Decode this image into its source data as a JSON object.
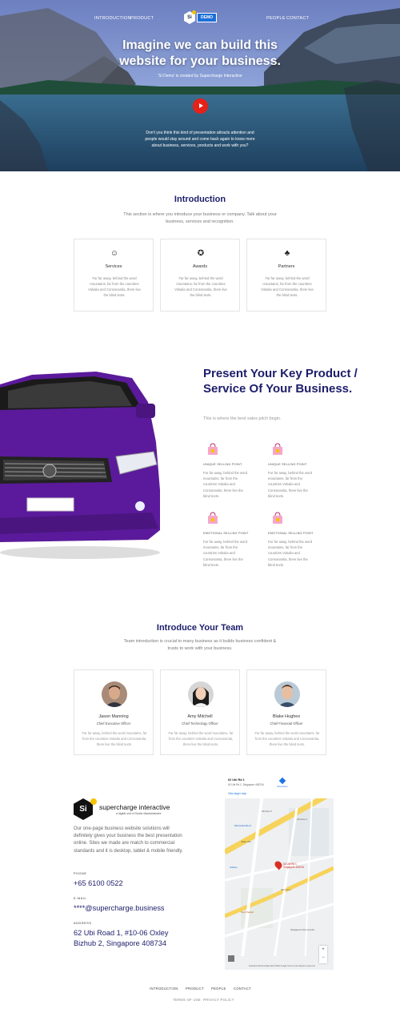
{
  "nav": {
    "links_left": [
      "INTRODUCTION",
      "PRODUCT"
    ],
    "links_right": [
      "PEOPLE",
      "CONTACT"
    ],
    "logo_text": "Si",
    "badge": "DEMO"
  },
  "hero": {
    "title_line1": "Imagine we can build this",
    "title_line2": "website for your business.",
    "subtitle": "'Si Demo' is created by Supercharge Interactive",
    "description": "Don't you think this kind of presentation attracts attention and people would stay around and come back again to know more about business, services, products and work with you?"
  },
  "intro": {
    "title": "Introduction",
    "subtitle": "This section is where you introduce your business or company. Talk about your business, services and recognition.",
    "cards": [
      {
        "icon": "services-icon",
        "title": "Services",
        "text": "Far far away, behind the word mountains, far from the countries Vokalia and Consonantia, there live the blind texts."
      },
      {
        "icon": "awards-icon",
        "title": "Awards",
        "text": "Far far away, behind the word mountains, far from the countries Vokalia and Consonantia, there live the blind texts."
      },
      {
        "icon": "partners-icon",
        "title": "Partners",
        "text": "Far far away, behind the word mountains, far from the countries Vokalia and Consonantia, there live the blind texts."
      }
    ]
  },
  "product": {
    "title": "Present Your Key Product / Service Of Your Business.",
    "subtitle": "This is where the best sales pitch begin.",
    "points": [
      {
        "label": "UNIQUE SELLING POINT",
        "text": "Far far away, behind the word mountains, far from the countries Vokalia and Consonantia, there live the blind texts."
      },
      {
        "label": "UNIQUE SELLING POINT",
        "text": "Far far away, behind the word mountains, far from the countries Vokalia and Consonantia, there live the blind texts."
      },
      {
        "label": "EMOTIONAL SELLING POINT",
        "text": "Far far away, behind the word mountains, far from the countries Vokalia and Consonantia, there live the blind texts."
      },
      {
        "label": "EMOTIONAL SELLING POINT",
        "text": "Far far away, behind the word mountains, far from the countries Vokalia and Consonantia, there live the blind texts."
      }
    ]
  },
  "team": {
    "title": "Introduce Your Team",
    "subtitle": "Team introduction is crucial to many business as it builds business confident & trusts to work with your business.",
    "members": [
      {
        "name": "Jason Manning",
        "role": "Chief Executive Officer",
        "text": "Far far away, behind the word mountains, far from the countries Vokalia and Consonantia, there live the blind texts."
      },
      {
        "name": "Amy Mitchell",
        "role": "Chief Technology Officer",
        "text": "Far far away, behind the word mountains, far from the countries Vokalia and Consonantia, there live the blind texts."
      },
      {
        "name": "Blake Hughes",
        "role": "Chief Financial Officer",
        "text": "Far far away, behind the word mountains, far from the countries Vokalia and Consonantia, there live the blind texts."
      }
    ]
  },
  "contact": {
    "company": "supercharge interactive",
    "tagline": "a digital unit of Studio Mastarlakodre",
    "logo_text": "Si",
    "description": "Our one-page business website solutions will definitely gives your business the best presentation online. Sites we made are match to commercial standards and it is desktop, tablet & mobile friendly.",
    "phone_label": "PHONE",
    "phone": "+65 6100 0522",
    "email_label": "E-MAIL",
    "email": "****@supercharge.business",
    "address_label": "ADDRESS",
    "address_line1": "62 Ubi Road 1, #10-06 Oxley",
    "address_line2": "Bizhub 2, Singapore 408734"
  },
  "map": {
    "place": "62 Ubi Rd 1",
    "place_address": "62 Ubi Rd 1, Singapore 408734",
    "directions": "Directions",
    "view_larger": "View larger map",
    "pin_label": "62 Ubi Rd 1, Singapore 408734",
    "labels": [
      "Ubi Ave 3",
      "Ubi Ave 2",
      "Mercedes-Benz",
      "Jalan Ubi",
      "Subaru",
      "Ubi Ave 1",
      "Tea Chapter",
      "Singapore Post Centre"
    ],
    "footer": "Keyboard shortcuts  Map data ©2021 Google  Terms of Use  Report a map error",
    "zoom_in": "+",
    "zoom_out": "−"
  },
  "footer": {
    "links": [
      "INTRODUCTION",
      "PRODUCT",
      "PEOPLE",
      "CONTACT"
    ],
    "legal": [
      "TERMS OF USE",
      "PRIVACY POLICY"
    ]
  },
  "colors": {
    "accent": "#1d1d6b",
    "play": "#e62117",
    "badge": "#1d6fd8",
    "logo_dot": "#f5c400",
    "car": "#5b1a9b"
  }
}
